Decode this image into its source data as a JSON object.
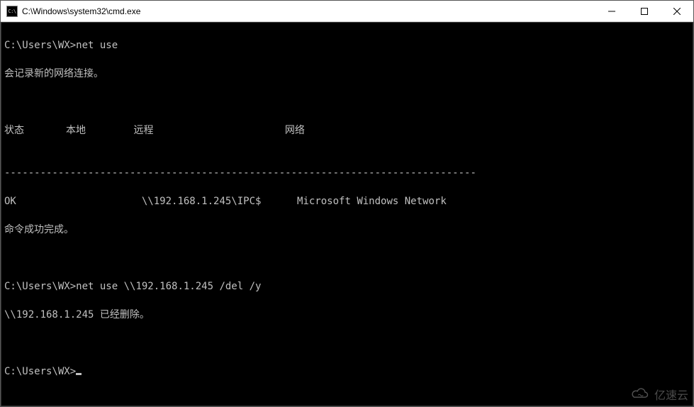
{
  "titlebar": {
    "icon_text": "C:\\",
    "title": "C:\\Windows\\system32\\cmd.exe"
  },
  "terminal": {
    "line1_prompt": "C:\\Users\\WX>",
    "line1_cmd": "net use",
    "line2": "会记录新的网络连接。",
    "blank1": "",
    "blank2": "",
    "header_status": "状态",
    "header_local": "本地",
    "header_remote": "远程",
    "header_network": "网络",
    "blank3": "",
    "separator": "-------------------------------------------------------------------------------",
    "row_status": "OK",
    "row_remote": "\\\\192.168.1.245\\IPC$",
    "row_network": "Microsoft Windows Network",
    "success": "命令成功完成。",
    "blank4": "",
    "blank5": "",
    "line_del_prompt": "C:\\Users\\WX>",
    "line_del_cmd": "net use \\\\192.168.1.245 /del /y",
    "deleted": "\\\\192.168.1.245 已经删除。",
    "blank6": "",
    "blank7": "",
    "final_prompt": "C:\\Users\\WX>"
  },
  "watermark": {
    "text": "亿速云"
  }
}
